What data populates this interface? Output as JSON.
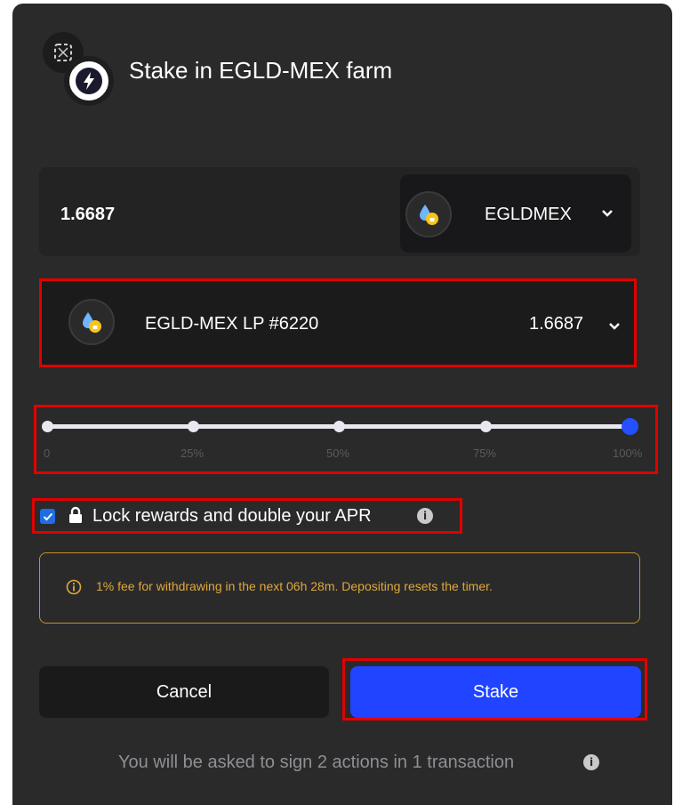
{
  "header": {
    "title": "Stake in EGLD-MEX farm"
  },
  "input": {
    "amount": "1.6687",
    "token_label": "EGLDMEX"
  },
  "lp_select": {
    "label": "EGLD-MEX LP #6220",
    "amount": "1.6687"
  },
  "slider": {
    "ticks": [
      "0",
      "25%",
      "50%",
      "75%",
      "100%"
    ],
    "value_percent": 100,
    "active_color": "#2450ff"
  },
  "lock": {
    "label": "Lock rewards and double your APR",
    "checked": true
  },
  "notice": {
    "text": "1% fee for withdrawing in the next 06h 28m. Depositing resets the timer.",
    "color": "#e0a83a"
  },
  "buttons": {
    "cancel": "Cancel",
    "stake": "Stake",
    "stake_color": "#2044ff"
  },
  "footer": {
    "text": "You will be asked to sign 2 actions in 1 transaction"
  },
  "icons": {
    "farm_logo": "farm-logo-icon",
    "lightning": "lightning-icon",
    "token": "egld-mex-token-icon",
    "chevron": "chevron-down-icon",
    "lock": "lock-icon",
    "info": "info-icon",
    "warning": "warning-icon"
  }
}
